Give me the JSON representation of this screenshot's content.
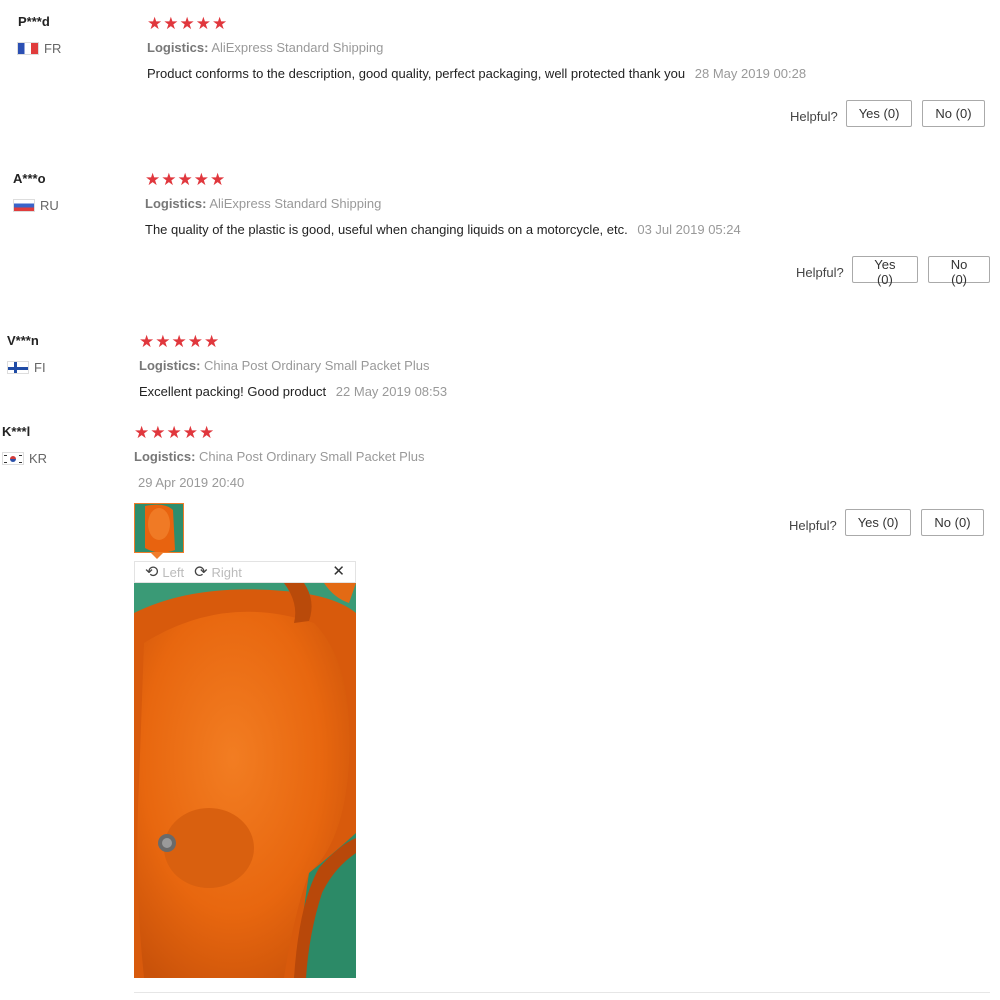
{
  "reviews": [
    {
      "user": "P***d",
      "country": "FR",
      "stars": "★★★★★",
      "logistics_label": "Logistics:",
      "logistics_value": "AliExpress Standard Shipping",
      "text": "Product conforms to the description, good quality, perfect packaging, well protected thank you",
      "date": "28 May 2019 00:28",
      "helpful_label": "Helpful?",
      "yes_label": "Yes (0)",
      "no_label": "No (0)"
    },
    {
      "user": "A***o",
      "country": "RU",
      "stars": "★★★★★",
      "logistics_label": "Logistics:",
      "logistics_value": "AliExpress Standard Shipping",
      "text": "The quality of the plastic is good, useful when changing liquids on a motorcycle, etc.",
      "date": "03 Jul 2019 05:24",
      "helpful_label": "Helpful?",
      "yes_label": "Yes (0)",
      "no_label": "No (0)"
    },
    {
      "user": "V***n",
      "country": "FI",
      "stars": "★★★★★",
      "logistics_label": "Logistics:",
      "logistics_value": "China Post Ordinary Small Packet Plus",
      "text": "Excellent packing! Good product",
      "date": "22 May 2019 08:53"
    },
    {
      "user": "K***l",
      "country": "KR",
      "stars": "★★★★★",
      "logistics_label": "Logistics:",
      "logistics_value": "China Post Ordinary Small Packet Plus",
      "date": "29 Apr 2019 20:40",
      "helpful_label": "Helpful?",
      "yes_label": "Yes (0)",
      "no_label": "No (0)"
    }
  ],
  "viewer": {
    "rotate_left_label": "Left",
    "rotate_right_label": "Right",
    "close_glyph": "✕",
    "rotate_left_icon": "rotate-left-icon",
    "rotate_right_icon": "rotate-right-icon"
  },
  "colors": {
    "star": "#e0373d",
    "thumb_border": "#f07c2a",
    "funnel_orange": "#e8630f",
    "background_green": "#2c8a67"
  }
}
